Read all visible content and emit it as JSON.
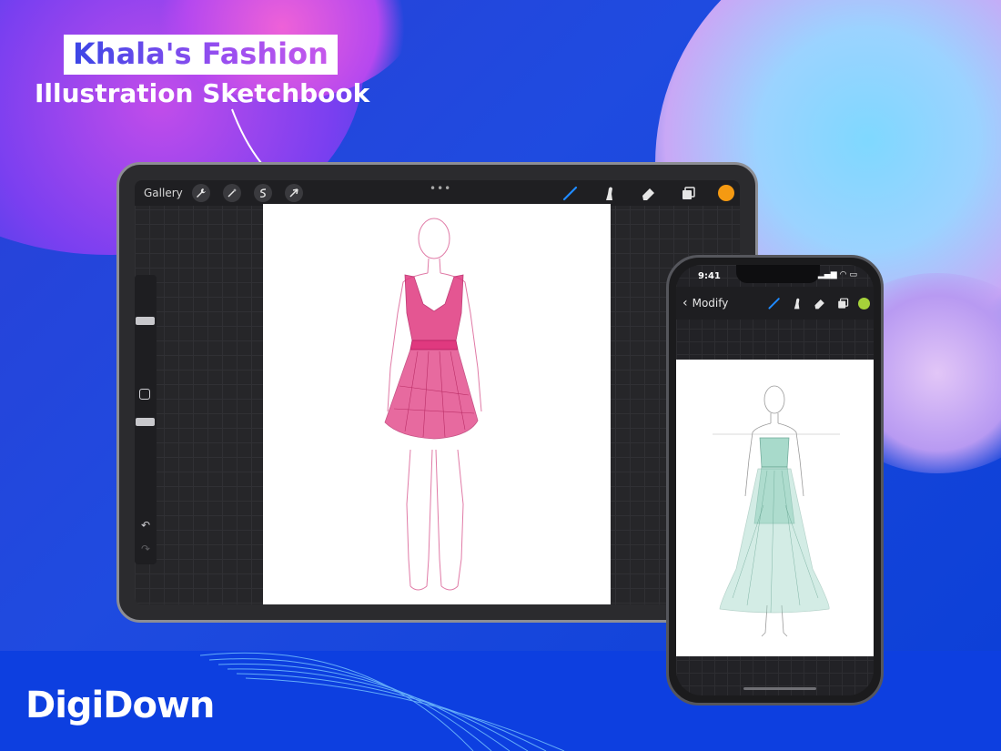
{
  "banner": {
    "title": "Khala's Fashion",
    "subtitle": "Illustration Sketchbook"
  },
  "brand": {
    "name": "DigiDown"
  },
  "tablet": {
    "gallery_label": "Gallery",
    "left_tools": [
      "wrench-icon",
      "magic-wand-icon",
      "selection-icon",
      "transform-arrow-icon"
    ],
    "more_label": "•••",
    "right_tools": [
      "brush-icon",
      "smudge-icon",
      "eraser-icon",
      "layers-icon"
    ],
    "active_color": "#f59a12",
    "sidebar": {
      "undo": "↶",
      "redo": "↷"
    }
  },
  "phone": {
    "time": "9:41",
    "back_label": "Modify",
    "right_tools": [
      "brush-icon",
      "smudge-icon",
      "eraser-icon",
      "layers-icon"
    ],
    "active_color": "#a6d23a"
  },
  "colors": {
    "brush_active": "#1f8bff",
    "dress_pink": "#e0397f",
    "dress_mint": "#9fd6c6"
  }
}
